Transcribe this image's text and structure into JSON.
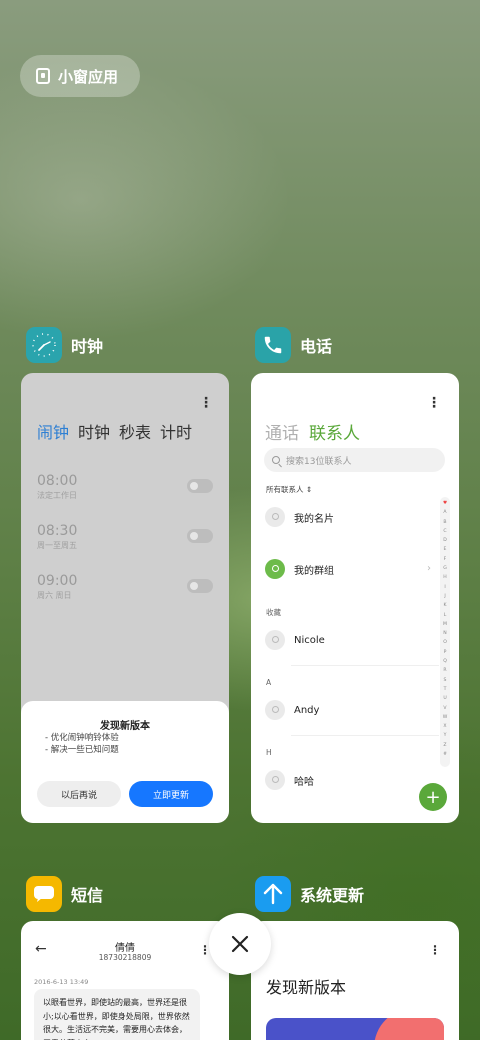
{
  "floating_window": {
    "label": "小窗应用"
  },
  "apps": {
    "clock": {
      "name": "时钟",
      "tabs": [
        "闹钟",
        "时钟",
        "秒表",
        "计时"
      ],
      "alarms": [
        {
          "time": "08:00",
          "days": "法定工作日"
        },
        {
          "time": "08:30",
          "days": "周一至周五"
        },
        {
          "time": "09:00",
          "days": "周六 周日"
        }
      ],
      "dialog": {
        "title": "发现新版本",
        "items": [
          "- 优化闹钟响铃体验",
          "- 解决一些已知问题"
        ],
        "later": "以后再说",
        "update_now": "立即更新"
      }
    },
    "phone": {
      "name": "电话",
      "tabs": {
        "calls": "通话",
        "contacts": "联系人"
      },
      "search_placeholder": "搜索13位联系人",
      "all_contacts": "所有联系人",
      "my_card": "我的名片",
      "my_groups": "我的群组",
      "favorites_header": "收藏",
      "contacts": [
        {
          "section": "",
          "name": "Nicole"
        },
        {
          "section": "A",
          "name": "Andy"
        },
        {
          "section": "H",
          "name": "哈哈"
        }
      ],
      "index_letters": [
        "♥",
        "A",
        "B",
        "C",
        "D",
        "E",
        "F",
        "G",
        "H",
        "I",
        "J",
        "K",
        "L",
        "M",
        "N",
        "O",
        "P",
        "Q",
        "R",
        "S",
        "T",
        "U",
        "V",
        "W",
        "X",
        "Y",
        "Z",
        "#"
      ]
    },
    "sms": {
      "name": "短信",
      "contact_name": "倩倩",
      "contact_number": "18730218809",
      "date": "2016-6-13 13:49",
      "message": "以眼看世界，即使站的最高，世界还是很小;以心看世界，即使身处局限，世界依然很大。生活远不完美，需要用心去体会，无需羡慕太多"
    },
    "update": {
      "name": "系统更新",
      "title": "发现新版本"
    }
  },
  "colors": {
    "accent_blue": "#1677ff",
    "clock_tab_active": "#2d7fd3",
    "phone_green": "#5aa83a",
    "sms_yellow": "#f5b800",
    "clock_icon_teal": "#2aa4ad",
    "phone_icon_teal": "#2aa3a8",
    "update_icon_blue": "#1a9cf0"
  }
}
